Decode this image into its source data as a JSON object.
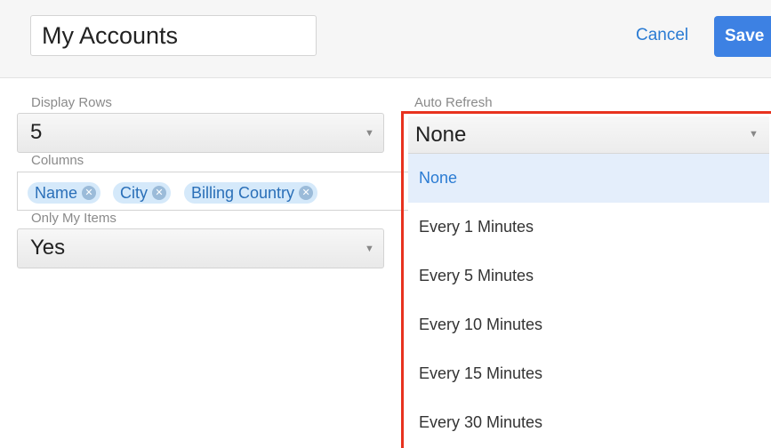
{
  "header": {
    "title_value": "My Accounts",
    "cancel_label": "Cancel",
    "save_label": "Save"
  },
  "display_rows": {
    "label": "Display Rows",
    "value": "5"
  },
  "columns": {
    "label": "Columns",
    "items": [
      "Name",
      "City",
      "Billing Country"
    ]
  },
  "only_my_items": {
    "label": "Only My Items",
    "value": "Yes"
  },
  "auto_refresh": {
    "label": "Auto Refresh",
    "value": "None",
    "options": [
      "None",
      "Every 1 Minutes",
      "Every 5 Minutes",
      "Every 10 Minutes",
      "Every 15 Minutes",
      "Every 30 Minutes"
    ]
  },
  "colors": {
    "accent": "#3d81e3",
    "highlight_border": "#e8321e",
    "pill_bg": "#d5e9fa"
  },
  "icons": {
    "caret": "caret-down-icon",
    "pill_remove": "remove-circle-icon"
  }
}
